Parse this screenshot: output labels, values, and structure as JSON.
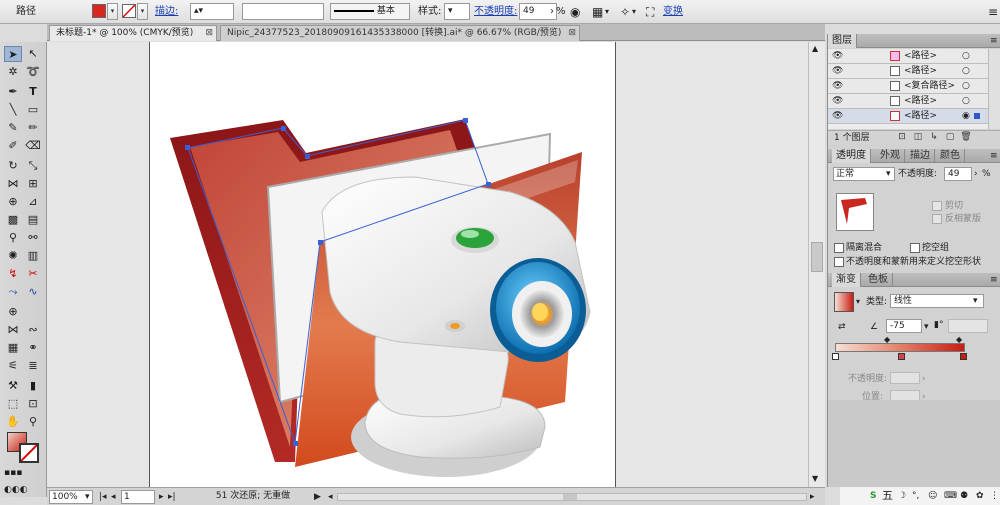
{
  "control_bar": {
    "selection_label": "路径",
    "stroke_link": "描边:",
    "stroke_profile": "基本",
    "style_label": "样式:",
    "opacity_link": "不透明度:",
    "opacity_value": "49",
    "percent": "%",
    "transform_link": "变换",
    "fill_color": "#d8271f"
  },
  "tabs": [
    {
      "label": "未标题-1* @ 100% (CMYK/预览)",
      "active": true
    },
    {
      "label": "Nipic_24377523_20180909161435338000 [转换].ai* @ 66.67% (RGB/预览)",
      "active": false
    }
  ],
  "status_bar": {
    "zoom": "100%",
    "artboard_num": "1",
    "undo_status": "51 次还原; 无重做"
  },
  "layers_panel": {
    "title": "图层",
    "rows": [
      "<路径>",
      "<路径>",
      "<复合路径>",
      "<路径>",
      "<路径>"
    ],
    "footer": "1 个图层"
  },
  "transparency_panel": {
    "tabs": [
      "透明度",
      "外观",
      "描边",
      "颜色"
    ],
    "blend_mode": "正常",
    "opacity_label": "不透明度:",
    "opacity_value": "49",
    "clip_label": "剪切",
    "invert_mask_label": "反相蒙版",
    "isolate_label": "隔离混合",
    "knockout_label": "挖空组",
    "opacity_mask_label": "不透明度和蒙新用来定义挖空形状"
  },
  "gradient_panel": {
    "tabs": [
      "渐变",
      "色板"
    ],
    "type_label": "类型:",
    "type_value": "线性",
    "angle_value": "-75",
    "opacity_label": "不透明度:",
    "location_label": "位置:",
    "start_color": "#f6dfd6",
    "end_color": "#c81d12"
  },
  "tray": {
    "ime": "五"
  },
  "colors": {
    "folder_back": "#a4201f",
    "folder_front": "#d85a33",
    "lens_ring": "#1e8fd0",
    "indicator": "#2aa33b",
    "selection_path": "#3b5fd6"
  }
}
